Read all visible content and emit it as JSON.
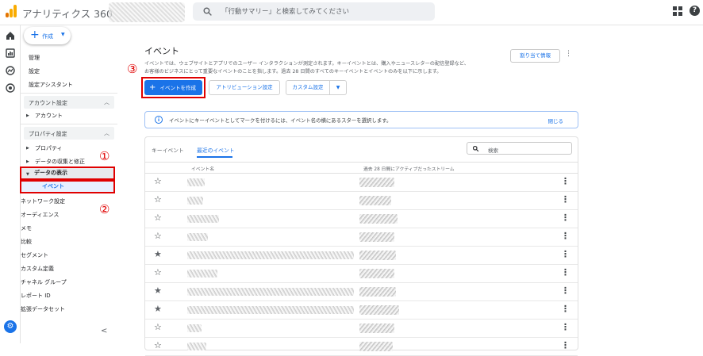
{
  "header": {
    "app_title": "アナリティクス 360",
    "search_placeholder": "「行動サマリー」と検索してみてください"
  },
  "nav": {
    "create_label": "作成",
    "top_items": [
      "管理",
      "設定",
      "設定アシスタント"
    ],
    "account_section": "アカウント設定",
    "account_items": [
      "アカウント"
    ],
    "property_section": "プロパティ設定",
    "property_items": [
      "プロパティ",
      "データの収集と修正",
      "データの表示"
    ],
    "data_display_items": [
      "イベント",
      "ネットワーク設定",
      "オーディエンス",
      "メモ",
      "比較",
      "セグメント",
      "カスタム定義",
      "チャネル グループ",
      "レポート ID",
      "拡張データセット"
    ]
  },
  "annotations": {
    "one": "①",
    "two": "②",
    "three": "③"
  },
  "main": {
    "title": "イベント",
    "description_line1": "イベントでは、ウェブサイトとアプリでのユーザー インタラクションが測定されます。キーイベントとは、購入やニュースレターの配信登録など、",
    "description_line2": "お客様のビジネスにとって重要なイベントのことを指します。過去 28 日間のすべてのキーイベントとイベントのみを以下に示します。",
    "assign_label": "割り当て情報",
    "create_event_label": "イベントを作成",
    "attribution_label": "アトリビューション設定",
    "custom_label": "カスタム設定",
    "banner_text": "イベントにキーイベントとしてマークを付けるには、イベント名の横にあるスターを選択します。",
    "banner_close": "閉じる",
    "tabs": [
      "キーイベント",
      "最近のイベント"
    ],
    "table_search_placeholder": "検索",
    "columns": [
      "イベント名",
      "過去 28 日間にアクティブだったストリーム"
    ],
    "rows": [
      {
        "starred": false
      },
      {
        "starred": false
      },
      {
        "starred": false
      },
      {
        "starred": false
      },
      {
        "starred": true
      },
      {
        "starred": false
      },
      {
        "starred": true
      },
      {
        "starred": true
      },
      {
        "starred": false
      },
      {
        "starred": false
      }
    ]
  },
  "colors": {
    "accent": "#1a73e8",
    "highlight_red": "#e00000"
  }
}
